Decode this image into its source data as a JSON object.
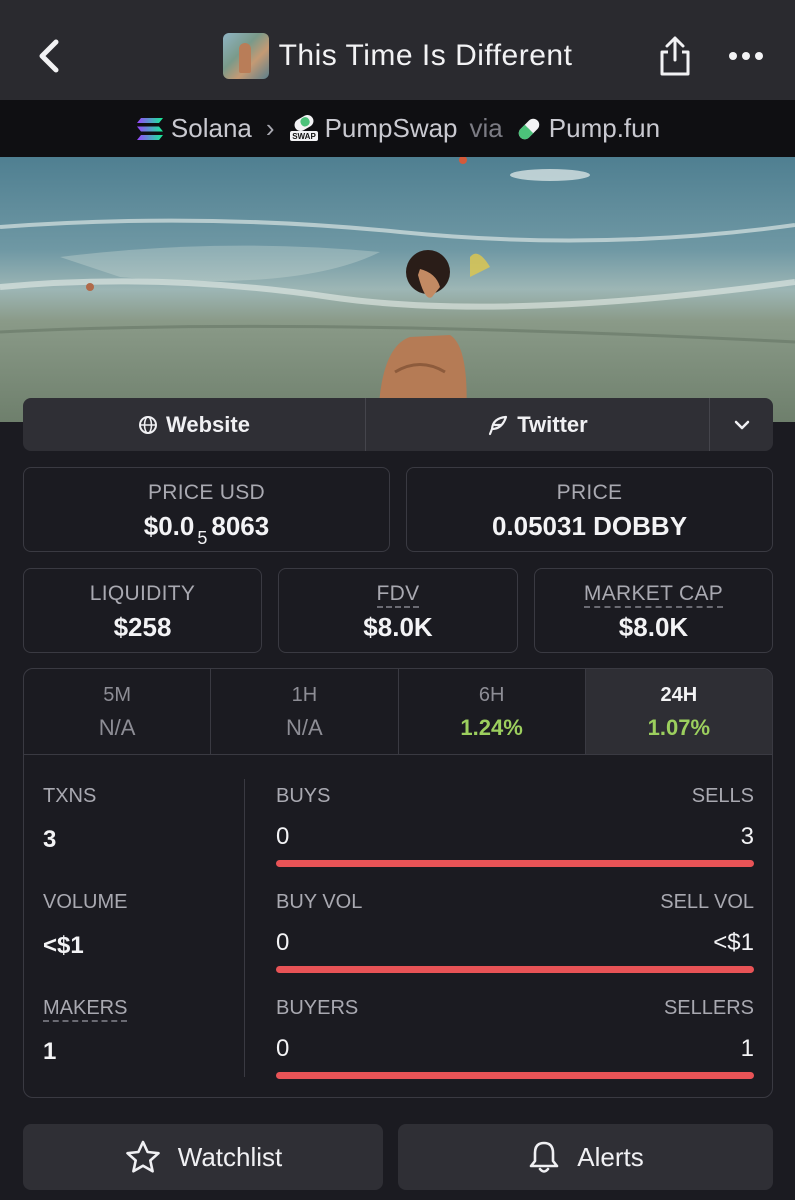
{
  "header": {
    "title": "This Time Is Different",
    "back_icon": "chevron-left-icon",
    "share_icon": "share-icon",
    "more_icon": "more-horizontal-icon"
  },
  "breadcrumb": {
    "chain": "Solana",
    "dex": "PumpSwap",
    "dex_badge": "SWAP",
    "via": "via",
    "launchpad": "Pump.fun"
  },
  "links": {
    "website": "Website",
    "twitter": "Twitter"
  },
  "stats": {
    "price_usd": {
      "label": "PRICE USD",
      "prefix": "$0.0",
      "zeros": "5",
      "digits": "8063"
    },
    "price": {
      "label": "PRICE",
      "value": "0.05031 DOBBY"
    },
    "liquidity": {
      "label": "LIQUIDITY",
      "value": "$258"
    },
    "fdv": {
      "label": "FDV",
      "value": "$8.0K"
    },
    "market_cap": {
      "label": "MARKET CAP",
      "value": "$8.0K"
    }
  },
  "timeframes": [
    {
      "label": "5M",
      "value": "N/A"
    },
    {
      "label": "1H",
      "value": "N/A"
    },
    {
      "label": "6H",
      "value": "1.24%"
    },
    {
      "label": "24H",
      "value": "1.07%"
    }
  ],
  "active_timeframe": "24H",
  "activity": {
    "txns": {
      "label": "TXNS",
      "value": "3",
      "left_label": "BUYS",
      "right_label": "SELLS",
      "left": "0",
      "right": "3",
      "buy_share": 0.0
    },
    "volume": {
      "label": "VOLUME",
      "value": "<$1",
      "left_label": "BUY VOL",
      "right_label": "SELL VOL",
      "left": "0",
      "right": "<$1",
      "buy_share": 0.0
    },
    "makers": {
      "label": "MAKERS",
      "value": "1",
      "left_label": "BUYERS",
      "right_label": "SELLERS",
      "left": "0",
      "right": "1",
      "buy_share": 0.0
    }
  },
  "actions": {
    "watchlist": "Watchlist",
    "alerts": "Alerts"
  },
  "colors": {
    "positive": "#9ccf5e",
    "sell_bar": "#e85356",
    "buy_bar": "#4cc27a",
    "background": "#1b1b21"
  }
}
